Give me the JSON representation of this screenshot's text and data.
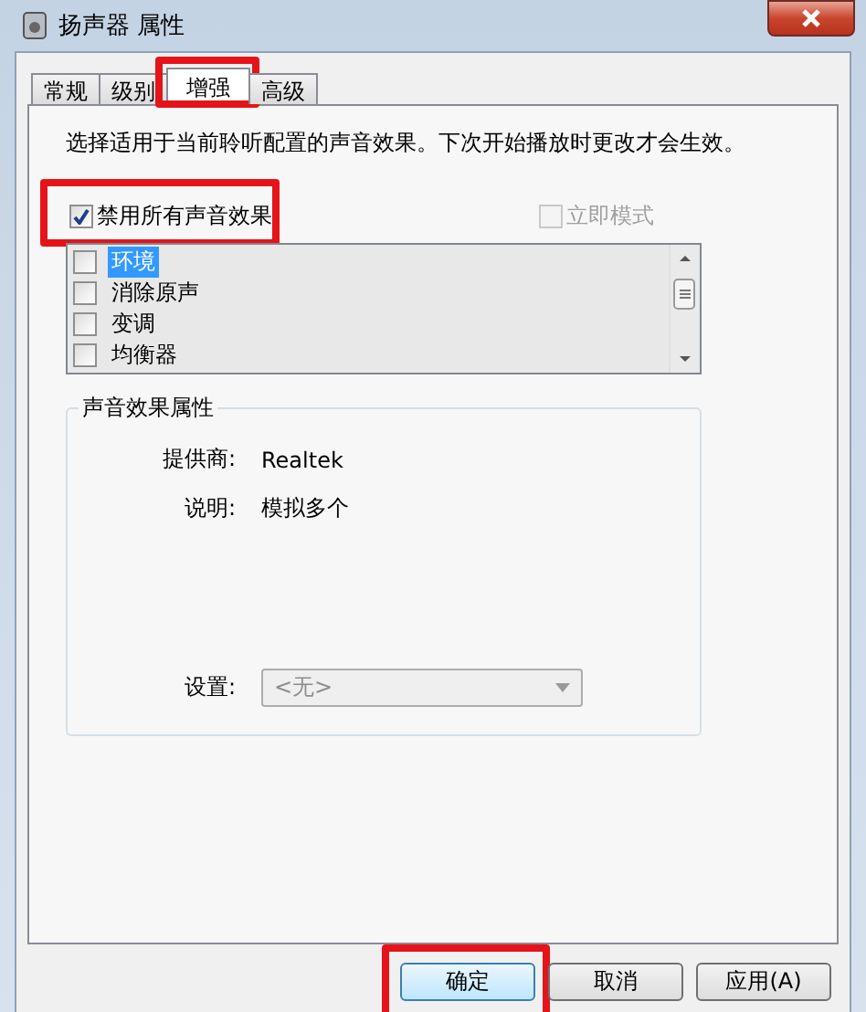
{
  "window": {
    "title": "扬声器 属性"
  },
  "tabs": [
    {
      "label": "常规",
      "selected": false,
      "highlight": false
    },
    {
      "label": "级别",
      "selected": false,
      "highlight": false
    },
    {
      "label": "增强",
      "selected": true,
      "highlight": true
    },
    {
      "label": "高级",
      "selected": false,
      "highlight": false
    }
  ],
  "description": "选择适用于当前聆听配置的声音效果。下次开始播放时更改才会生效。",
  "disable_all": {
    "label": "禁用所有声音效果",
    "checked": true,
    "highlight": true
  },
  "immediate_mode": {
    "label": "立即模式",
    "checked": false,
    "disabled": true
  },
  "effects": [
    {
      "label": "环境",
      "checked": false,
      "selected": true
    },
    {
      "label": "消除原声",
      "checked": false,
      "selected": false
    },
    {
      "label": "变调",
      "checked": false,
      "selected": false
    },
    {
      "label": "均衡器",
      "checked": false,
      "selected": false
    }
  ],
  "properties": {
    "title": "声音效果属性",
    "fields": [
      {
        "label": "提供商:",
        "value": "Realtek"
      },
      {
        "label": "说明:",
        "value": "模拟多个"
      }
    ],
    "setting": {
      "label": "设置:",
      "value": "<无>",
      "disabled": true
    }
  },
  "buttons": [
    {
      "label": "确定",
      "default": true,
      "highlight": true
    },
    {
      "label": "取消",
      "default": false,
      "highlight": false
    },
    {
      "label": "应用(A)",
      "default": false,
      "highlight": false
    }
  ]
}
